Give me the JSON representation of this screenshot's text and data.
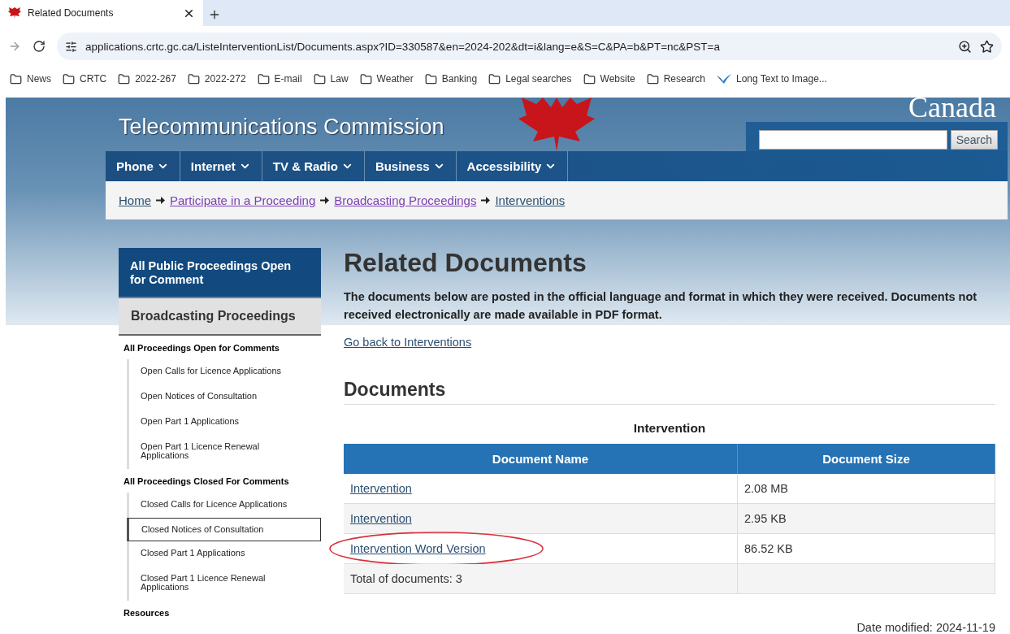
{
  "browser": {
    "tab": {
      "title": "Related Documents",
      "selected": true
    },
    "address": {
      "url": "applications.crtc.gc.ca/ListeInterventionList/Documents.aspx?ID=330587&en=2024-202&dt=i&lang=e&S=C&PA=b&PT=nc&PST=a"
    },
    "bookmarks": [
      {
        "label": "News",
        "kind": "folder"
      },
      {
        "label": "CRTC",
        "kind": "folder"
      },
      {
        "label": "2022-267",
        "kind": "folder"
      },
      {
        "label": "2022-272",
        "kind": "folder"
      },
      {
        "label": "E-mail",
        "kind": "folder"
      },
      {
        "label": "Law",
        "kind": "folder"
      },
      {
        "label": "Weather",
        "kind": "folder"
      },
      {
        "label": "Banking",
        "kind": "folder"
      },
      {
        "label": "Legal searches",
        "kind": "folder"
      },
      {
        "label": "Website",
        "kind": "folder"
      },
      {
        "label": "Research",
        "kind": "folder"
      },
      {
        "label": "Long Text to Image...",
        "kind": "site"
      }
    ]
  },
  "header": {
    "title": "Telecommunications Commission",
    "wordmark": "Canada",
    "search_button": "Search",
    "nav": [
      "Phone",
      "Internet",
      "TV & Radio",
      "Business",
      "Accessibility"
    ]
  },
  "breadcrumb": [
    {
      "label": "Home",
      "visited": false
    },
    {
      "label": "Participate in a Proceeding",
      "visited": true
    },
    {
      "label": "Broadcasting Proceedings",
      "visited": true
    },
    {
      "label": "Interventions",
      "visited": false
    }
  ],
  "sidebar": {
    "heading": "All Public Proceedings Open for Comment",
    "section": "Broadcasting Proceedings",
    "groups": [
      {
        "title": "All Proceedings Open for Comments",
        "items": [
          {
            "label": "Open Calls for Licence Applications",
            "selected": false
          },
          {
            "label": "Open Notices of Consultation",
            "selected": false
          },
          {
            "label": "Open Part 1 Applications",
            "selected": false
          },
          {
            "label": "Open Part 1 Licence Renewal Applications",
            "selected": false
          }
        ]
      },
      {
        "title": "All Proceedings Closed For Comments",
        "items": [
          {
            "label": "Closed Calls for Licence Applications",
            "selected": false
          },
          {
            "label": "Closed Notices of Consultation",
            "selected": true
          },
          {
            "label": "Closed Part 1 Applications",
            "selected": false
          },
          {
            "label": "Closed Part 1 Licence Renewal Applications",
            "selected": false
          }
        ]
      },
      {
        "title": "Resources"
      }
    ]
  },
  "main": {
    "title": "Related Documents",
    "intro": "The documents below are posted in the official language and format in which they were received. Documents not received electronically are made available in PDF format.",
    "back_link": "Go back to Interventions",
    "documents_heading": "Documents",
    "table": {
      "caption": "Intervention",
      "columns": [
        "Document Name",
        "Document Size"
      ],
      "rows": [
        {
          "name": "Intervention",
          "size": "2.08 MB",
          "circled": false
        },
        {
          "name": "Intervention",
          "size": "2.95 KB",
          "circled": false
        },
        {
          "name": "Intervention Word Version",
          "size": "86.52 KB",
          "circled": true
        }
      ],
      "total": "Total of documents: 3"
    },
    "date_modified": "Date modified: 2024-11-19"
  }
}
